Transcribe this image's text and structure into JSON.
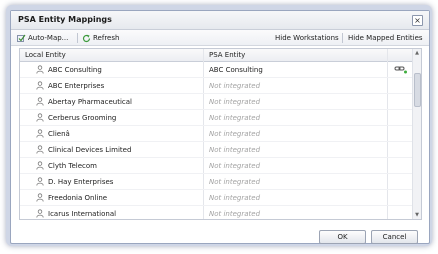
{
  "dialog": {
    "title": "PSA Entity Mappings",
    "close_glyph": "×"
  },
  "toolbar": {
    "auto_map_label": "Auto-Map...",
    "refresh_label": "Refresh",
    "hide_workstations_label": "Hide Workstations",
    "hide_mapped_label": "Hide Mapped Entities"
  },
  "grid": {
    "columns": [
      "Local Entity",
      "PSA Entity"
    ],
    "rows": [
      {
        "local": "ABC Consulting",
        "psa": "ABC Consulting",
        "mapped": true
      },
      {
        "local": "ABC Enterprises",
        "psa": "Not integrated",
        "mapped": false
      },
      {
        "local": "Abertay Pharmaceutical",
        "psa": "Not integrated",
        "mapped": false
      },
      {
        "local": "Cerberus Grooming",
        "psa": "Not integrated",
        "mapped": false
      },
      {
        "local": "Clienâ",
        "psa": "Not integrated",
        "mapped": false
      },
      {
        "local": "Clinical Devices Limited",
        "psa": "Not integrated",
        "mapped": false
      },
      {
        "local": "Clyth Telecom",
        "psa": "Not integrated",
        "mapped": false
      },
      {
        "local": "D. Hay Enterprises",
        "psa": "Not integrated",
        "mapped": false
      },
      {
        "local": "Freedonia Online",
        "psa": "Not integrated",
        "mapped": false
      },
      {
        "local": "Icarus International",
        "psa": "Not integrated",
        "mapped": false
      }
    ]
  },
  "buttons": {
    "ok": "OK",
    "cancel": "Cancel"
  },
  "icons": {
    "row": "person-icon",
    "mapped": "link-icon",
    "auto_map": "auto-map-icon",
    "refresh": "refresh-icon"
  },
  "colors": {
    "not_integrated": "#a3a3a3",
    "dialog_border": "#9aa6bf"
  }
}
